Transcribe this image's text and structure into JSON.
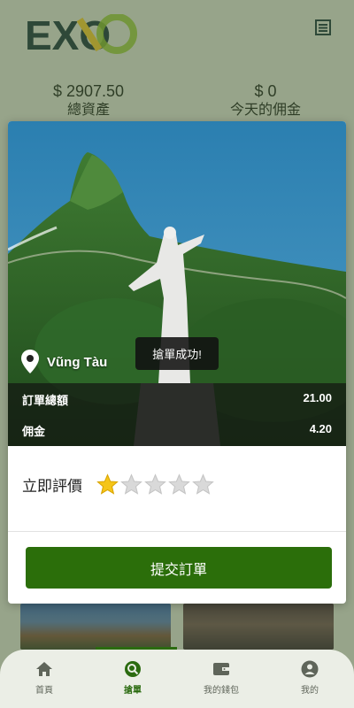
{
  "header": {
    "logo_text": "EXO",
    "menu_icon": "list-icon"
  },
  "stats": {
    "total_assets_value": "$ 2907.50",
    "total_assets_label": "總資產",
    "today_commission_value": "$ 0",
    "today_commission_label": "今天的佣金"
  },
  "modal": {
    "location": "Vũng Tàu",
    "toast": "搶單成功!",
    "order_total_label": "訂單總額",
    "order_total_value": "21.00",
    "commission_label": "佣金",
    "commission_value": "4.20",
    "rate_label": "立即評價",
    "rating": {
      "value": 1,
      "max": 5
    },
    "submit_label": "提交訂單"
  },
  "bottom_nav": {
    "items": [
      {
        "label": "首頁",
        "icon": "home-icon",
        "active": false
      },
      {
        "label": "搶單",
        "icon": "search-order-icon",
        "active": true
      },
      {
        "label": "我的錢包",
        "icon": "wallet-icon",
        "active": false
      },
      {
        "label": "我的",
        "icon": "user-icon",
        "active": false
      }
    ]
  },
  "colors": {
    "brand_green": "#2b6e0a",
    "star_gold": "#f5c518",
    "star_gray": "#d9d9d9"
  }
}
